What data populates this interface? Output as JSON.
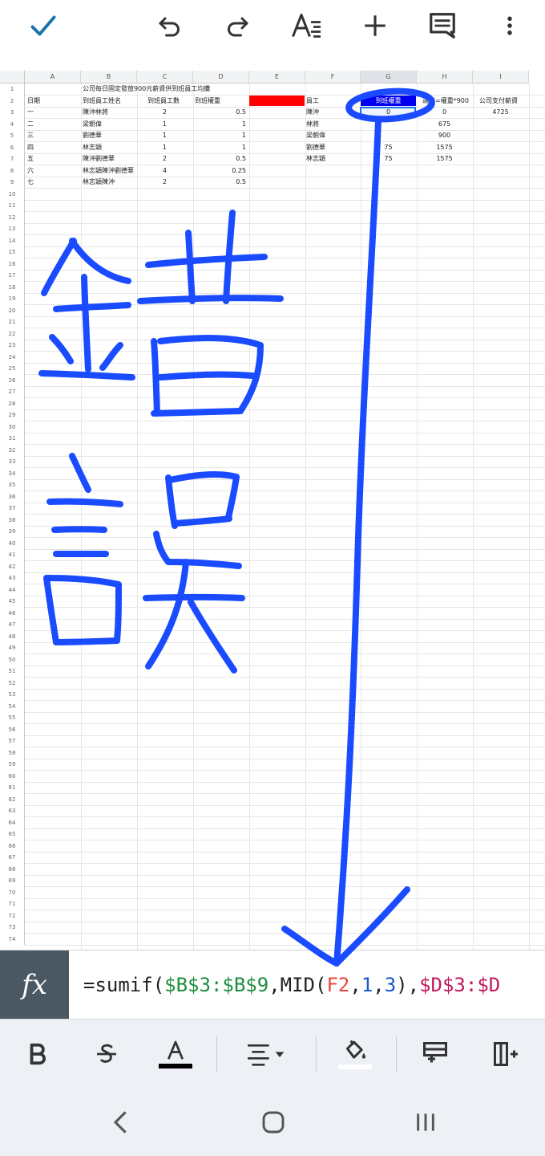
{
  "topbar": {
    "icons": [
      "check-icon",
      "undo-icon",
      "redo-icon",
      "text-format-icon",
      "plus-icon",
      "comment-icon",
      "more-vert-icon"
    ]
  },
  "sheet": {
    "columns": [
      "A",
      "B",
      "C",
      "D",
      "E",
      "F",
      "G",
      "H",
      "I"
    ],
    "selected_column": "G",
    "row_count": 74,
    "cells": {
      "title": "公司每日固定發放900元薪資供到班員工均攤",
      "A2": "日期",
      "B2": "到班員工姓名",
      "C2": "到班員工數",
      "D2": "到班權重",
      "F2": "員工",
      "G2": "到班權重",
      "H2": "週薪=權重*900",
      "I2": "公司支付薪資",
      "A3": "一",
      "B3": "陳沖林將",
      "C3": "2",
      "D3": "0.5",
      "F3": "陳沖",
      "G3": "0",
      "H3": "0",
      "I3": "4725",
      "A4": "二",
      "B4": "梁朝偉",
      "C4": "1",
      "D4": "1",
      "F4": "林將",
      "H4": "675",
      "A5": "三",
      "B5": "劉德華",
      "C5": "1",
      "D5": "1",
      "F5": "梁朝偉",
      "H5": "900",
      "A6": "四",
      "B6": "林志穎",
      "C6": "1",
      "D6": "1",
      "F6": "劉德華",
      "G6": "75",
      "H6": "1575",
      "A7": "五",
      "B7": "陳沖劉德華",
      "C7": "2",
      "D7": "0.5",
      "F7": "林志穎",
      "G7": "75",
      "H7": "1575",
      "A8": "六",
      "B8": "林志穎陳沖劉德華",
      "C8": "4",
      "D8": "0.25",
      "A9": "七",
      "B9": "林志穎陳沖",
      "C9": "2",
      "D9": "0.5"
    },
    "highlight_colors": {
      "E2": "#ff0000",
      "G2": "#0000ee"
    }
  },
  "annotation": {
    "handwritten_text": "錯誤",
    "ink_color": "#1a4bff"
  },
  "formula": {
    "icon_label": "fx",
    "text": "=sumif($B$3:$B$9,MID(F2,1,3),$D$3:$D"
  },
  "format_toolbar": {
    "icons": [
      "bold-icon",
      "strikethrough-icon",
      "text-color-icon",
      "align-icon",
      "fill-color-icon",
      "insert-row-icon",
      "insert-column-icon"
    ]
  },
  "navbar": {
    "icons": [
      "back-icon",
      "home-icon",
      "recents-icon"
    ]
  }
}
